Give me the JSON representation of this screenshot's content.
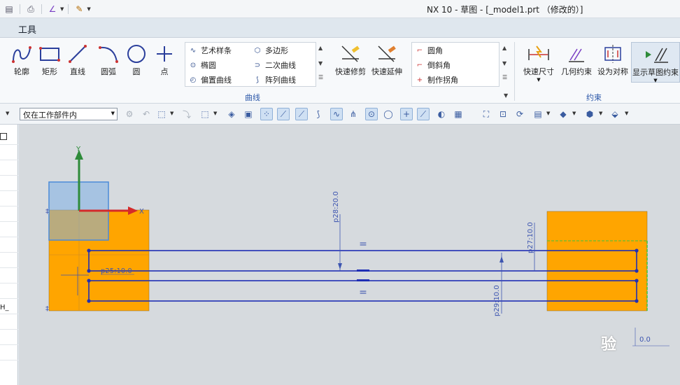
{
  "window": {
    "title": "NX 10 - 草图 - [_model1.prt （修改的）]"
  },
  "menubar": {
    "tools": "工具"
  },
  "ribbon": {
    "curve_buttons": [
      {
        "label": "轮廓",
        "icon": "profile-icon"
      },
      {
        "label": "矩形",
        "icon": "rectangle-icon"
      },
      {
        "label": "直线",
        "icon": "line-icon"
      },
      {
        "label": "圆弧",
        "icon": "arc-icon"
      },
      {
        "label": "圆",
        "icon": "circle-icon"
      },
      {
        "label": "点",
        "icon": "point-icon"
      }
    ],
    "gallery_left": [
      {
        "label": "艺术样条",
        "icon": "studio-spline-icon"
      },
      {
        "label": "多边形",
        "icon": "polygon-icon"
      },
      {
        "label": "椭圆",
        "icon": "ellipse-icon"
      },
      {
        "label": "二次曲线",
        "icon": "conic-icon"
      },
      {
        "label": "偏置曲线",
        "icon": "offset-curve-icon"
      },
      {
        "label": "阵列曲线",
        "icon": "pattern-curve-icon"
      }
    ],
    "edit_buttons": [
      {
        "label": "快速修剪",
        "icon": "quick-trim-icon"
      },
      {
        "label": "快速延伸",
        "icon": "quick-extend-icon"
      }
    ],
    "gallery_right": [
      {
        "label": "圆角",
        "icon": "fillet-icon"
      },
      {
        "label": "倒斜角",
        "icon": "chamfer-icon"
      },
      {
        "label": "制作拐角",
        "icon": "make-corner-icon"
      }
    ],
    "constraint_buttons": [
      {
        "label": "快速尺寸",
        "icon": "rapid-dimension-icon"
      },
      {
        "label": "几何约束",
        "icon": "geometric-constraint-icon"
      },
      {
        "label": "设为对称",
        "icon": "make-symmetric-icon"
      },
      {
        "label": "显示草图约束",
        "icon": "show-constraints-icon"
      }
    ],
    "group_curve": "曲线",
    "group_constraint": "约束"
  },
  "toolbar2": {
    "selection_scope": "仅在工作部件内"
  },
  "sidepanel": {
    "cut_text": "H_"
  },
  "sketch": {
    "axis_x": "X",
    "axis_y": "Y",
    "dims": {
      "p25": "p25:10.0",
      "p28": "p28:20.0",
      "p29": "p29:10.0",
      "p27": "p27:10.0",
      "bottom_right": "0.0"
    },
    "equal_symbol": "=",
    "watermark": "验"
  },
  "colors": {
    "block": "#ffa500",
    "sketch_line": "#1f2fb5",
    "dim_text": "#3d55b0",
    "csys_y": "#2e8b3a",
    "csys_x": "#d42a2a",
    "highlight": "#7fb0e6"
  }
}
